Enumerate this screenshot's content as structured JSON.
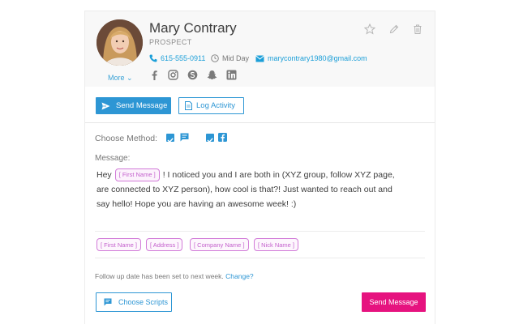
{
  "contact": {
    "name": "Mary Contrary",
    "status": "PROSPECT",
    "phone": "615-555-0911",
    "best_time": "Mid Day",
    "email": "marycontrary1980@gmail.com",
    "more_label": "More",
    "social_icons": [
      "facebook-icon",
      "instagram-icon",
      "skype-icon",
      "snapchat-icon",
      "linkedin-icon"
    ],
    "header_icons": [
      "star-icon",
      "pencil-icon",
      "trash-icon"
    ]
  },
  "actions": {
    "send_message_label": "Send Message",
    "log_activity_label": "Log Activity"
  },
  "method": {
    "label": "Choose Method:",
    "options": [
      {
        "icon": "message-icon",
        "checked": true
      },
      {
        "icon": "facebook-icon",
        "checked": true
      }
    ]
  },
  "message": {
    "label": "Message:",
    "text_before": "Hey",
    "inline_token": "[ First Name ]",
    "text_after": "! I noticed you and I are both in (XYZ group, follow XYZ page, are connected to XYZ person), how cool is that?! Just wanted to reach out and say hello! Hope you are having an awesome week! :)"
  },
  "tokens": [
    "[ First Name ]",
    "[ Address ]",
    "[ Company Name ]",
    "[ Nick Name ]"
  ],
  "followup": {
    "text": "Follow up date has been set to next week.",
    "change_label": "Change?"
  },
  "footer": {
    "scripts_label": "Choose Scripts",
    "send_label": "Send Message"
  },
  "colors": {
    "primary": "#2d96d4",
    "accent": "#e6137f",
    "token": "#d27bd8"
  }
}
